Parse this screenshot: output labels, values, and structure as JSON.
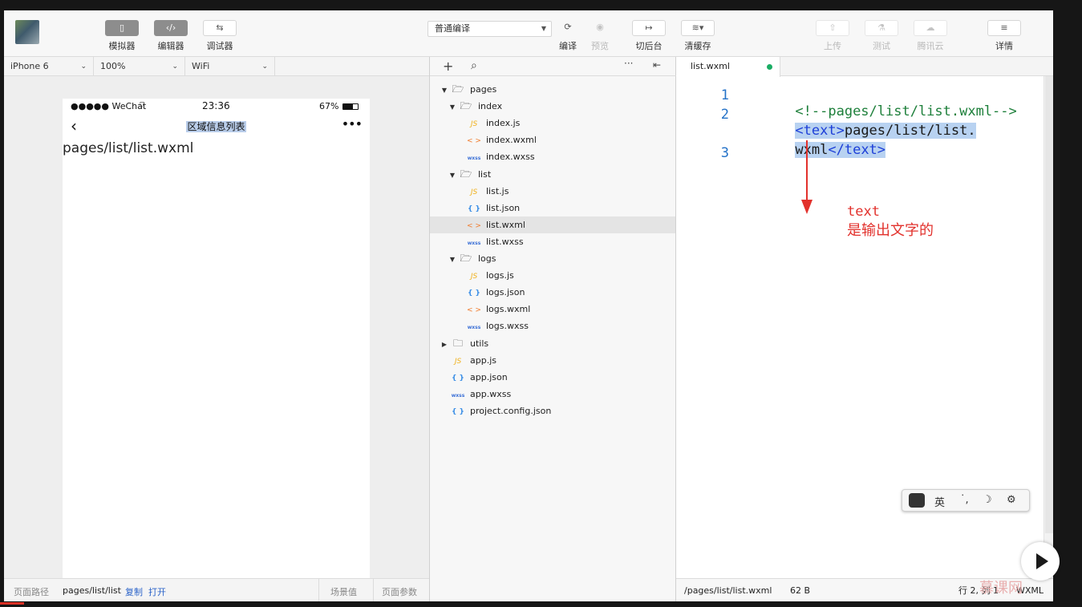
{
  "toolbar": {
    "simulator": {
      "icon": "phone-icon",
      "label": "模拟器"
    },
    "editor": {
      "icon": "code-icon",
      "label": "编辑器"
    },
    "debugger": {
      "icon": "debug-icon",
      "label": "调试器"
    },
    "compile_mode": "普通编译",
    "compile": "编译",
    "preview": "预览",
    "background": "切后台",
    "clear_cache": "清缓存",
    "upload": "上传",
    "test": "测试",
    "tencent_cloud": "腾讯云",
    "details": "详情"
  },
  "device_bar": {
    "device": "iPhone 6",
    "zoom": "100%",
    "network": "WiFi"
  },
  "phone": {
    "carrier": "●●●●● WeChat",
    "time": "23:36",
    "battery": "67%",
    "nav_title": "区域信息列表",
    "nav_menu": "•••",
    "content": "pages/list/list.wxml"
  },
  "sim_footer": {
    "path_label": "页面路径",
    "path": "pages/list/list",
    "copy": "复制",
    "open": "打开",
    "scene": "场景值",
    "params": "页面参数"
  },
  "file_tree": [
    {
      "name": "pages",
      "type": "folder",
      "depth": 0,
      "open": true
    },
    {
      "name": "index",
      "type": "folder",
      "depth": 1,
      "open": true
    },
    {
      "name": "index.js",
      "type": "js",
      "depth": 2
    },
    {
      "name": "index.wxml",
      "type": "wxml",
      "depth": 2
    },
    {
      "name": "index.wxss",
      "type": "wxss",
      "depth": 2
    },
    {
      "name": "list",
      "type": "folder",
      "depth": 1,
      "open": true
    },
    {
      "name": "list.js",
      "type": "js",
      "depth": 2
    },
    {
      "name": "list.json",
      "type": "json",
      "depth": 2
    },
    {
      "name": "list.wxml",
      "type": "wxml",
      "depth": 2,
      "selected": true
    },
    {
      "name": "list.wxss",
      "type": "wxss",
      "depth": 2
    },
    {
      "name": "logs",
      "type": "folder",
      "depth": 1,
      "open": true
    },
    {
      "name": "logs.js",
      "type": "js",
      "depth": 2
    },
    {
      "name": "logs.json",
      "type": "json",
      "depth": 2
    },
    {
      "name": "logs.wxml",
      "type": "wxml",
      "depth": 2
    },
    {
      "name": "logs.wxss",
      "type": "wxss",
      "depth": 2
    },
    {
      "name": "utils",
      "type": "folder",
      "depth": 0,
      "open": false
    },
    {
      "name": "app.js",
      "type": "js",
      "depth": 0
    },
    {
      "name": "app.json",
      "type": "json",
      "depth": 0
    },
    {
      "name": "app.wxss",
      "type": "wxss",
      "depth": 0
    },
    {
      "name": "project.config.json",
      "type": "json",
      "depth": 0
    }
  ],
  "icons": {
    "js": "JS",
    "json": "{ }",
    "wxml": "< >",
    "wxss": "wxss"
  },
  "editor": {
    "tab": "list.wxml",
    "line_numbers": [
      "1",
      "2",
      "3"
    ],
    "line1": "<!--pages/list/list.wxml-->",
    "line2_open": "<text>",
    "line2_text": "pages/list/list.",
    "line2b_text": "wxml",
    "line2_close": "</text>"
  },
  "annotation": {
    "line1": "text",
    "line2": "是输出文字的",
    "color": "#e2312c"
  },
  "editor_footer": {
    "path": "/pages/list/list.wxml",
    "size": "62 B",
    "position": "行 2, 列 1",
    "lang": "WXML"
  },
  "ime": {
    "lang": "英"
  },
  "watermark": "慕课网"
}
